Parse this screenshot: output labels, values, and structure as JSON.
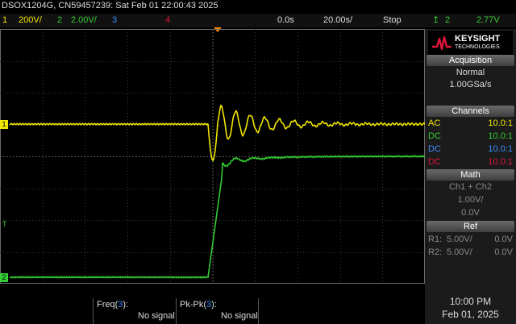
{
  "header": {
    "device_line": "DSOX1204G, CN59457239: Sat Feb 01 22:00:43 2025",
    "ch1_label": "1",
    "ch1_scale": "200V/",
    "ch2_label": "2",
    "ch2_scale": "2.00V/",
    "ch3_label": "3",
    "ch4_label": "4",
    "time_delay": "0.0s",
    "time_scale": "20.00s/",
    "run_state": "Stop",
    "trig_channel": "2",
    "trig_level": "2.77V"
  },
  "brand": {
    "name": "KEYSIGHT",
    "sub": "TECHNOLOGIES"
  },
  "acquisition": {
    "title": "Acquisition",
    "mode": "Normal",
    "rate": "1.00GSa/s"
  },
  "channels": {
    "title": "Channels",
    "rows": [
      {
        "coupling": "AC",
        "probe": "10.0:1",
        "color": "#f2e600"
      },
      {
        "coupling": "DC",
        "probe": "10.0:1",
        "color": "#33cc33"
      },
      {
        "coupling": "DC",
        "probe": "10.0:1",
        "color": "#3d8bff"
      },
      {
        "coupling": "DC",
        "probe": "10.0:1",
        "color": "#e0143c"
      }
    ]
  },
  "math": {
    "title": "Math",
    "function": "Ch1 + Ch2",
    "scale": "1.00V/",
    "offset": "0.0V"
  },
  "ref": {
    "title": "Ref",
    "r1_label": "R1:",
    "r1_scale": "5.00V/",
    "r1_offset": "0.0V",
    "r2_label": "R2:",
    "r2_scale": "5.00V/",
    "r2_offset": "0.0V"
  },
  "measurements": {
    "freq_label": "Freq(",
    "freq_ch": "3",
    "freq_close": "):",
    "freq_value": "No signal",
    "pkpk_label": "Pk-Pk(",
    "pkpk_ch": "3",
    "pkpk_close": "):",
    "pkpk_value": "No signal"
  },
  "clock": {
    "time": "10:00 PM",
    "date": "Feb 01, 2025"
  },
  "markers": {
    "ch1_ground": "1",
    "ch2_ground": "2",
    "trigger": "T"
  },
  "colors": {
    "ch1": "#f2e600",
    "ch2": "#33cc33",
    "ch3": "#3d8bff",
    "ch4": "#e0143c",
    "trigger_marker": "#ff8c00",
    "brand_red": "#e0143c"
  }
}
